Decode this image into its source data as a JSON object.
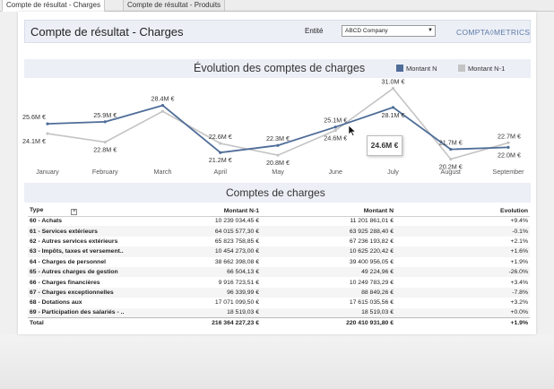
{
  "tabs": [
    {
      "label": "Compte de résultat - Charges",
      "active": true
    },
    {
      "label": "Compte de résultat - Produits",
      "active": false
    }
  ],
  "header": {
    "title": "Compte de résultat - Charges",
    "entity_label": "Entité",
    "entity_value": "ABCD Company",
    "logo": "COMPTA◊METRICS"
  },
  "chart": {
    "title": "Évolution des comptes de charges",
    "tooltip": "24.6M €",
    "colors": {
      "current": "#4e6d98",
      "previous": "#c4c4c4"
    }
  },
  "chart_data": {
    "type": "line",
    "title": "Évolution des comptes de charges",
    "categories": [
      "January",
      "February",
      "March",
      "April",
      "May",
      "June",
      "July",
      "August",
      "September"
    ],
    "series": [
      {
        "name": "Montant N",
        "values": [
          25.6,
          25.9,
          28.4,
          21.2,
          22.3,
          25.1,
          28.1,
          21.7,
          22.0
        ],
        "labels": [
          "25.6M €",
          "25.9M €",
          "28.4M €",
          "21.2M €",
          "22.3M €",
          "25.1M €",
          "28.1M €",
          "21.7M €",
          "22.0M €"
        ]
      },
      {
        "name": "Montant N-1",
        "values": [
          24.1,
          22.8,
          27.5,
          22.6,
          20.8,
          24.6,
          31.0,
          20.2,
          22.7
        ],
        "labels": [
          "24.1M €",
          "22.8M €",
          "",
          "22.6M €",
          "20.8M €",
          "24.6M €",
          "31.0M €",
          "20.2M €",
          "22.7M €"
        ]
      }
    ],
    "grid": false,
    "legend": "top-right"
  },
  "table": {
    "title": "Comptes de charges",
    "columns": [
      "Type",
      "Montant N-1",
      "Montant N",
      "Evolution"
    ],
    "rows": [
      [
        "60 - Achats",
        "10 239 034,45 €",
        "11 201 861,01 €",
        "+9.4%"
      ],
      [
        "61 - Services extérieurs",
        "64 015 577,30 €",
        "63 925 288,40 €",
        "-0.1%"
      ],
      [
        "62 - Autres services extérieurs",
        "65 823 758,85 €",
        "67 236 193,82 €",
        "+2.1%"
      ],
      [
        "63 - Impôts, taxes et versement..",
        "10 454 273,00 €",
        "10 625 220,42 €",
        "+1.6%"
      ],
      [
        "64 - Charges de personnel",
        "38 662 398,08 €",
        "39 400 956,05 €",
        "+1.9%"
      ],
      [
        "65 - Autres charges de gestion",
        "66 504,13 €",
        "49 224,96 €",
        "-26.0%"
      ],
      [
        "66 - Charges financières",
        "9 916 723,51 €",
        "10 249 783,29 €",
        "+3.4%"
      ],
      [
        "67 - Charges exceptionnelles",
        "96 339,99 €",
        "88 849,26 €",
        "-7.8%"
      ],
      [
        "68 - Dotations aux",
        "17 071 099,50 €",
        "17 615 035,56 €",
        "+3.2%"
      ],
      [
        "69 - Participation des salariés - ..",
        "18 519,03 €",
        "18 519,03 €",
        "+0.0%"
      ]
    ],
    "total": [
      "Total",
      "216 364 227,23 €",
      "220 410 931,80 €",
      "+1.9%"
    ]
  }
}
